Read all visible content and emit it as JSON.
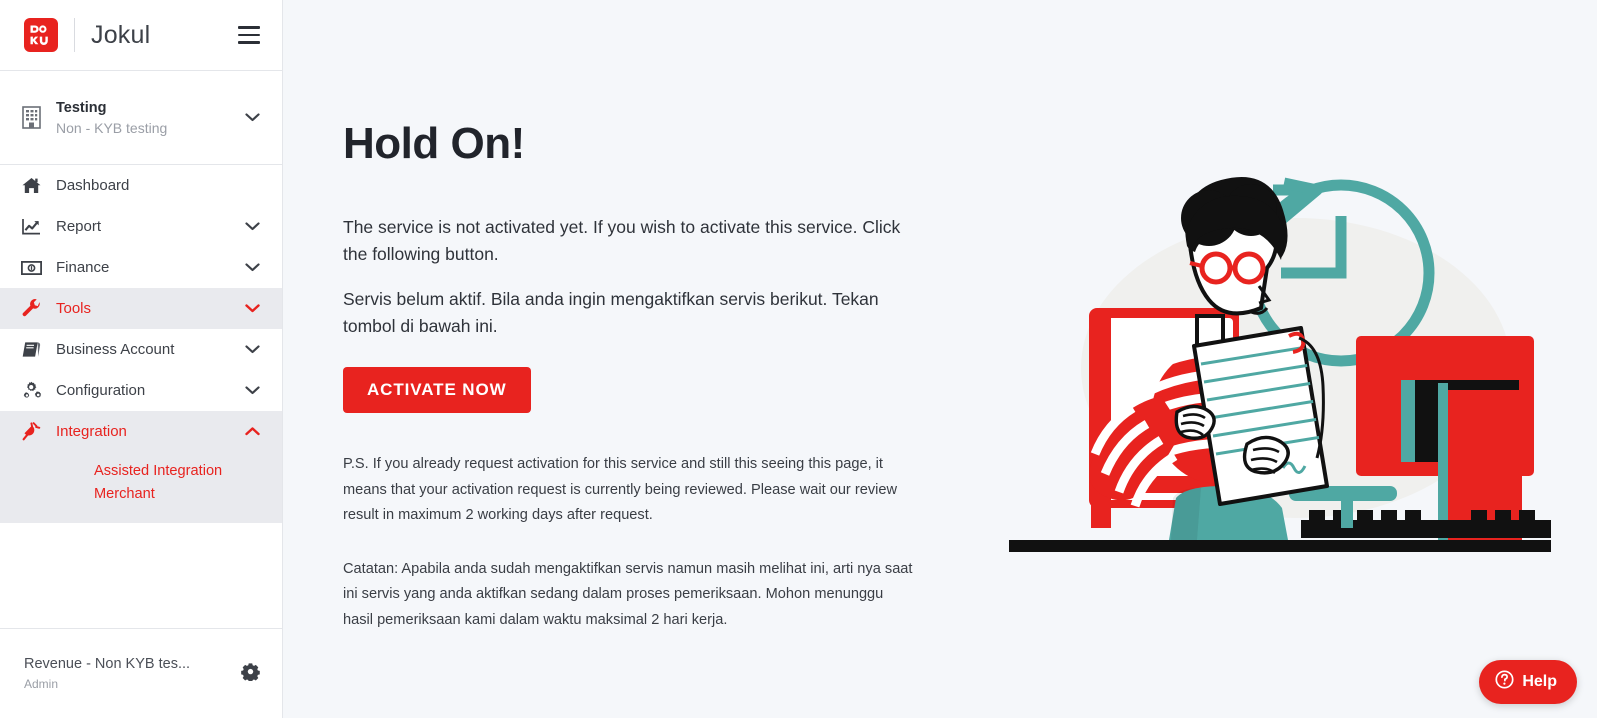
{
  "brand": {
    "logo_alt": "doku-logo",
    "logo_line1": "DO",
    "logo_line2": "KU",
    "name": "Jokul",
    "menu_toggle": "hamburger-menu"
  },
  "org": {
    "name": "Testing",
    "subtitle": "Non - KYB testing",
    "caret": "chevron-down"
  },
  "sidebar": {
    "items": [
      {
        "label": "Dashboard",
        "icon": "home-icon",
        "caret": "",
        "state": "default"
      },
      {
        "label": "Report",
        "icon": "chart-line-icon",
        "caret": "chevron-down",
        "state": "default"
      },
      {
        "label": "Finance",
        "icon": "banknote-icon",
        "caret": "chevron-down",
        "state": "default"
      },
      {
        "label": "Tools",
        "icon": "wrench-icon",
        "caret": "chevron-down",
        "state": "active"
      },
      {
        "label": "Business Account",
        "icon": "book-icon",
        "caret": "chevron-down",
        "state": "default"
      },
      {
        "label": "Configuration",
        "icon": "gears-icon",
        "caret": "chevron-down",
        "state": "default"
      }
    ],
    "integration": {
      "label": "Integration",
      "icon": "plug-icon",
      "caret": "chevron-up",
      "submenu": [
        {
          "label": "Assisted Integration Merchant"
        }
      ]
    }
  },
  "footer": {
    "account_name": "Revenue - Non KYB tes...",
    "role": "Admin",
    "settings_icon": "gear-icon"
  },
  "main": {
    "headline": "Hold On!",
    "lead_en": "The service is not activated yet. If you wish to activate this service. Click the following button.",
    "lead_id": "Servis belum aktif. Bila anda ingin mengaktifkan servis berikut. Tekan tombol di bawah ini.",
    "activate_label": "ACTIVATE NOW",
    "note_en": "P.S. If you already request activation for this service and still this seeing this page, it means that your activation request is currently being reviewed. Please wait our review result in maximum 2 working days after request.",
    "note_id": "Catatan: Apabila anda sudah mengaktifkan servis namun masih melihat ini, arti nya saat ini servis yang anda aktifkan sedang dalam proses pemeriksaan. Mohon menunggu hasil pemeriksaan kami dalam waktu maksimal 2 hari kerja.",
    "illustration_alt": "woman-reviewing-document-with-clock-illustration"
  },
  "help": {
    "label": "Help",
    "icon": "question-circle-icon"
  },
  "colors": {
    "brand_red": "#e8231f",
    "teal": "#4fa8a3",
    "sidebar_bg": "#ffffff",
    "sidebar_active_bg": "#e9eaee",
    "content_bg": "#f5f7fa",
    "heading": "#21242b",
    "text": "#3a3e45",
    "muted": "#9a9ea6"
  }
}
